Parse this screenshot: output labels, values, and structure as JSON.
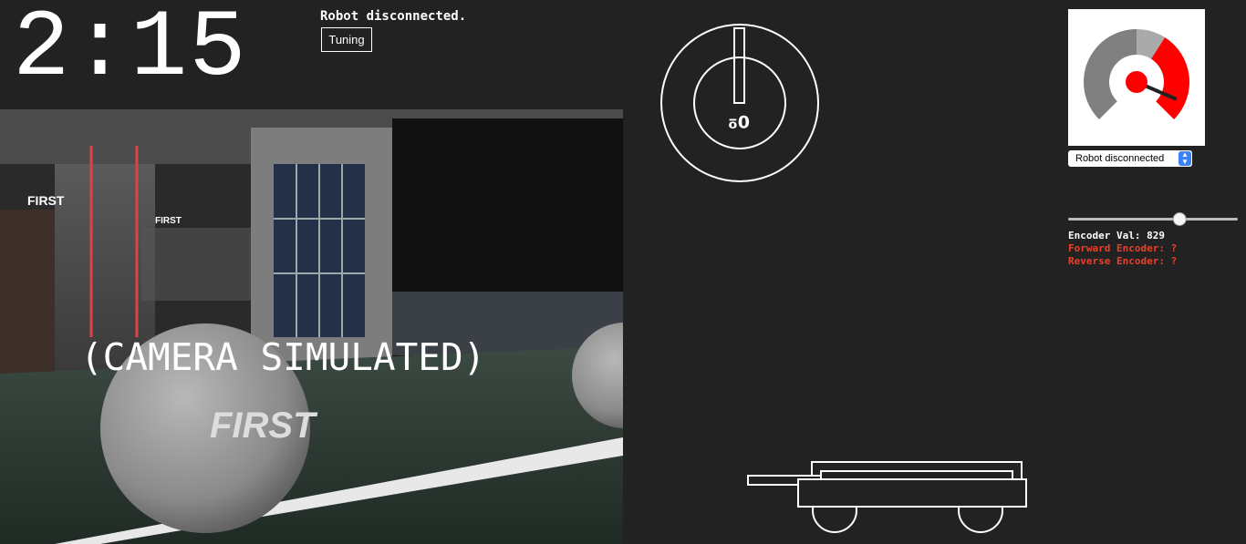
{
  "timer": {
    "text": "2:15"
  },
  "status": {
    "text": "Robot disconnected."
  },
  "tuning": {
    "label": "Tuning"
  },
  "camera": {
    "label": "(CAMERA SIMULATED)"
  },
  "gyro": {
    "value": "0º",
    "angle_deg": 0
  },
  "gauge": {
    "value_fraction": 0.92,
    "colors": {
      "low": "#808080",
      "mid": "#aaaaaa",
      "high": "#ff0000"
    }
  },
  "auto_select": {
    "selected": "Robot disconnected"
  },
  "encoder": {
    "slider_fraction": 0.67,
    "val_line": "Encoder Val: 829",
    "forward_line": "Forward Encoder: ?",
    "reverse_line": "Reverse Encoder: ?"
  },
  "colors": {
    "background": "#222222",
    "warning": "#e8402a"
  }
}
